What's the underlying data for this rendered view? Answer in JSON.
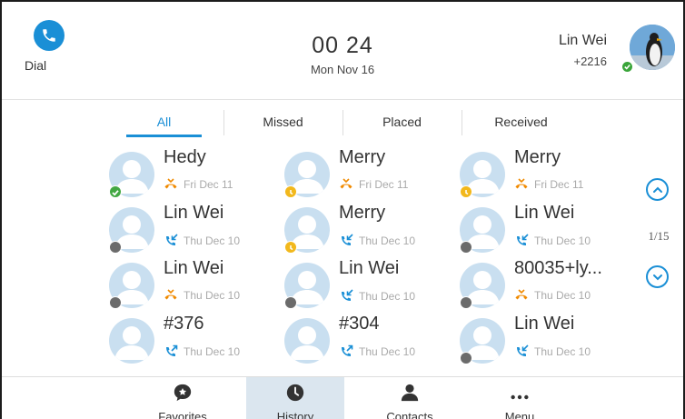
{
  "header": {
    "dial_label": "Dial",
    "time": "00 24",
    "date": "Mon Nov 16",
    "account_name": "Lin Wei",
    "account_number": "+2216"
  },
  "tabs": [
    "All",
    "Missed",
    "Placed",
    "Received"
  ],
  "active_tab": "All",
  "entries": [
    {
      "name": "Hedy",
      "date": "Fri Dec 11",
      "call_type": "missed",
      "presence": "online"
    },
    {
      "name": "Merry",
      "date": "Fri Dec 11",
      "call_type": "missed",
      "presence": "away"
    },
    {
      "name": "Merry",
      "date": "Fri Dec 11",
      "call_type": "missed",
      "presence": "away"
    },
    {
      "name": "Lin Wei",
      "date": "Thu Dec 10",
      "call_type": "received",
      "presence": "offline"
    },
    {
      "name": "Merry",
      "date": "Thu Dec 10",
      "call_type": "received",
      "presence": "away"
    },
    {
      "name": "Lin Wei",
      "date": "Thu Dec 10",
      "call_type": "received",
      "presence": "offline"
    },
    {
      "name": "Lin Wei",
      "date": "Thu Dec 10",
      "call_type": "missed",
      "presence": "offline"
    },
    {
      "name": "Lin Wei",
      "date": "Thu Dec 10",
      "call_type": "received",
      "presence": "offline"
    },
    {
      "name": "80035+ly...",
      "date": "Thu Dec 10",
      "call_type": "missed",
      "presence": "offline"
    },
    {
      "name": "#376",
      "date": "Thu Dec 10",
      "call_type": "placed",
      "presence": "none"
    },
    {
      "name": "#304",
      "date": "Thu Dec 10",
      "call_type": "placed",
      "presence": "none"
    },
    {
      "name": "Lin Wei",
      "date": "Thu Dec 10",
      "call_type": "received",
      "presence": "offline"
    }
  ],
  "pagination": {
    "current": 1,
    "total": 15,
    "label": "1/15"
  },
  "bottom_nav": [
    {
      "label": "Favorites",
      "icon": "star-bubble-icon"
    },
    {
      "label": "History",
      "icon": "clock-icon"
    },
    {
      "label": "Contacts",
      "icon": "person-icon"
    },
    {
      "label": "Menu",
      "icon": "more-dots-icon"
    }
  ],
  "active_nav": "History",
  "colors": {
    "accent": "#1a8fd6",
    "missed_icon": "#f08a00",
    "received_icon": "#1a8fd6",
    "placed_icon": "#1a8fd6",
    "presence_online": "#43a843",
    "presence_away": "#f2b81c",
    "presence_offline": "#6b6b6b",
    "avatar_bg": "#c9dff0"
  }
}
